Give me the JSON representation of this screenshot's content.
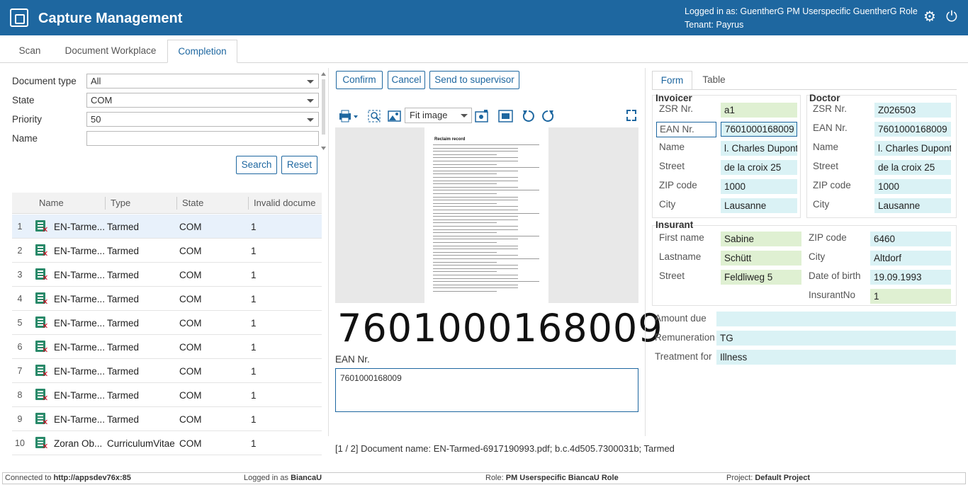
{
  "header": {
    "app_title": "Capture Management",
    "logged_in": "Logged in as: GuentherG",
    "role": "PM Userspecific GuentherG Role",
    "tenant": "Tenant: Payrus",
    "settings_icon": "gear-icon",
    "power_icon": "power-icon"
  },
  "tabs": [
    {
      "label": "Scan"
    },
    {
      "label": "Document Workplace"
    },
    {
      "label": "Completion"
    }
  ],
  "filter": {
    "doc_type_label": "Document type",
    "doc_type_value": "All",
    "state_label": "State",
    "state_value": "COM",
    "priority_label": "Priority",
    "priority_value": "50",
    "name_label": "Name",
    "name_value": "",
    "search_label": "Search",
    "reset_label": "Reset"
  },
  "grid": {
    "columns": [
      "Name",
      "Type",
      "State",
      "Invalid docume"
    ],
    "rows": [
      {
        "num": "1",
        "name": "EN-Tarme...",
        "type": "Tarmed",
        "state": "COM",
        "invalid": "1"
      },
      {
        "num": "2",
        "name": "EN-Tarme...",
        "type": "Tarmed",
        "state": "COM",
        "invalid": "1"
      },
      {
        "num": "3",
        "name": "EN-Tarme...",
        "type": "Tarmed",
        "state": "COM",
        "invalid": "1"
      },
      {
        "num": "4",
        "name": "EN-Tarme...",
        "type": "Tarmed",
        "state": "COM",
        "invalid": "1"
      },
      {
        "num": "5",
        "name": "EN-Tarme...",
        "type": "Tarmed",
        "state": "COM",
        "invalid": "1"
      },
      {
        "num": "6",
        "name": "EN-Tarme...",
        "type": "Tarmed",
        "state": "COM",
        "invalid": "1"
      },
      {
        "num": "7",
        "name": "EN-Tarme...",
        "type": "Tarmed",
        "state": "COM",
        "invalid": "1"
      },
      {
        "num": "8",
        "name": "EN-Tarme...",
        "type": "Tarmed",
        "state": "COM",
        "invalid": "1"
      },
      {
        "num": "9",
        "name": "EN-Tarme...",
        "type": "Tarmed",
        "state": "COM",
        "invalid": "1"
      },
      {
        "num": "10",
        "name": "Zoran Ob...",
        "type": "CurriculumVitae",
        "state": "COM",
        "invalid": "1"
      }
    ]
  },
  "actions": {
    "confirm": "Confirm",
    "cancel": "Cancel",
    "supervisor": "Send to supervisor"
  },
  "viewer": {
    "fit_value": "Fit image",
    "page_title": "Reclaim record",
    "barcode": "7601000168009",
    "ean_label": "EAN Nr.",
    "ean_value": "7601000168009",
    "doc_info": "[1 / 2] Document name: EN-Tarmed-6917190993.pdf; b.c.4d505.7300031b; Tarmed"
  },
  "form_tabs": {
    "form": "Form",
    "table": "Table"
  },
  "invoicer": {
    "title": "Invoicer",
    "fields": [
      {
        "label": "ZSR Nr.",
        "value": "a1"
      },
      {
        "label": "EAN Nr.",
        "value": "7601000168009"
      },
      {
        "label": "Name",
        "value": "l. Charles Dupont"
      },
      {
        "label": "Street",
        "value": "de la croix 25"
      },
      {
        "label": "ZIP code",
        "value": "1000"
      },
      {
        "label": "City",
        "value": "Lausanne"
      }
    ]
  },
  "doctor": {
    "title": "Doctor",
    "fields": [
      {
        "label": "ZSR Nr.",
        "value": "Z026503"
      },
      {
        "label": "EAN Nr.",
        "value": "7601000168009"
      },
      {
        "label": "Name",
        "value": "l. Charles Dupont"
      },
      {
        "label": "Street",
        "value": "de la croix 25"
      },
      {
        "label": "ZIP code",
        "value": "1000"
      },
      {
        "label": "City",
        "value": "Lausanne"
      }
    ]
  },
  "insurant": {
    "title": "Insurant",
    "left": [
      {
        "label": "First name",
        "value": "Sabine"
      },
      {
        "label": "Lastname",
        "value": "Schütt"
      },
      {
        "label": "Street",
        "value": "Feldliweg 5"
      }
    ],
    "right": [
      {
        "label": "ZIP code",
        "value": "6460"
      },
      {
        "label": "City",
        "value": "Altdorf"
      },
      {
        "label": "Date of birth",
        "value": "19.09.1993"
      },
      {
        "label": "InsurantNo",
        "value": "1"
      }
    ]
  },
  "extra": [
    {
      "label": "Amount due",
      "value": ""
    },
    {
      "label": "Remuneration",
      "value": "TG"
    },
    {
      "label": "Treatment for",
      "value": "Illness"
    }
  ],
  "status": {
    "connected_prefix": "Connected to",
    "connected_url": "http://appsdev76x:85",
    "logged_prefix": "Logged in as",
    "logged_user": "BiancaU",
    "role_prefix": "Role:",
    "role_value": "PM Userspecific BiancaU Role",
    "project_prefix": "Project:",
    "project_value": "Default Project"
  }
}
